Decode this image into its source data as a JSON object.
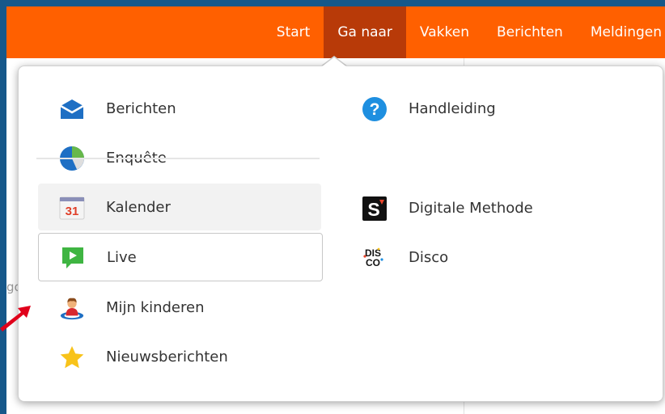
{
  "navbar": {
    "items": [
      {
        "label": "Start"
      },
      {
        "label": "Ga naar",
        "active": true
      },
      {
        "label": "Vakken"
      },
      {
        "label": "Berichten"
      },
      {
        "label": "Meldingen"
      }
    ]
  },
  "background": {
    "partial_text": "go"
  },
  "dropdown": {
    "left": [
      {
        "label": "Berichten",
        "icon": "envelope-icon"
      },
      {
        "label": "Enquête",
        "icon": "pie-chart-icon"
      },
      {
        "label": "Kalender",
        "icon": "calendar-icon",
        "calendar_day": "31"
      },
      {
        "label": "Live",
        "icon": "chat-play-icon"
      },
      {
        "label": "Mijn kinderen",
        "icon": "person-icon"
      },
      {
        "label": "Nieuwsberichten",
        "icon": "star-icon"
      }
    ],
    "right": [
      {
        "label": "Handleiding",
        "icon": "help-icon",
        "glyph": "?"
      },
      {
        "label": "Digitale Methode",
        "icon": "s-logo-icon",
        "glyph": "S"
      },
      {
        "label": "Disco",
        "icon": "disco-logo-icon",
        "glyph_top": "DIS",
        "glyph_bottom": "CO"
      }
    ]
  },
  "colors": {
    "brand_orange": "#ff6000",
    "active_tab": "#b83a08",
    "frame_blue": "#16588a",
    "annotation_arrow": "#e0001b"
  }
}
